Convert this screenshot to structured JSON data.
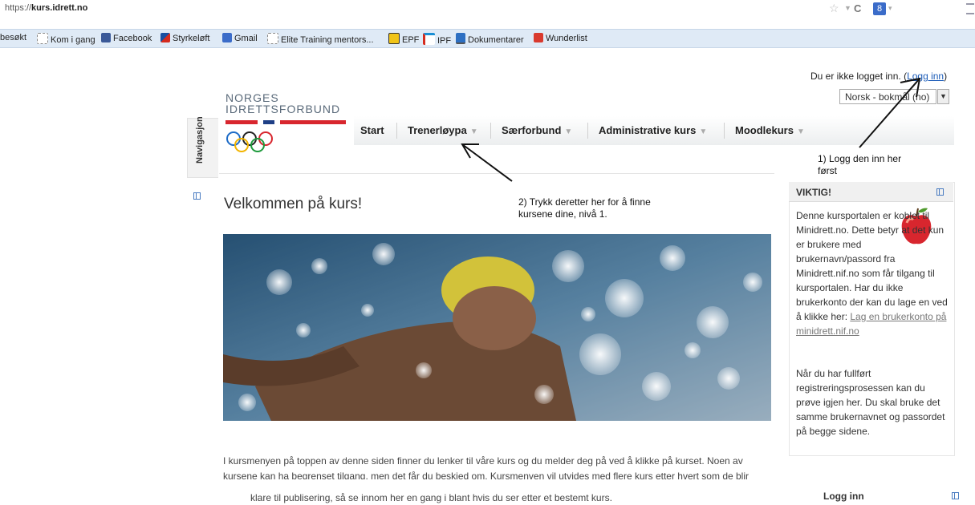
{
  "browser": {
    "url_scheme": "https://",
    "url_host": "kurs.idrett.no",
    "bookmarks": [
      {
        "label": "besøkt",
        "icon": "page-icon"
      },
      {
        "label": "Kom i gang",
        "icon": "page-icon"
      },
      {
        "label": "Facebook",
        "icon": "facebook-icon"
      },
      {
        "label": "Styrkeløft",
        "icon": "styrkeloft-icon"
      },
      {
        "label": "Gmail",
        "icon": "google-icon"
      },
      {
        "label": "Elite Training mentors...",
        "icon": "page-icon"
      },
      {
        "label": "EPF",
        "icon": "epf-icon"
      },
      {
        "label": "IPF",
        "icon": "ipf-icon"
      },
      {
        "label": "Dokumentarer",
        "icon": "monitor-icon"
      },
      {
        "label": "Wunderlist",
        "icon": "wunderlist-icon"
      }
    ],
    "google_badge": "8"
  },
  "header": {
    "logo_line1": "NORGES",
    "logo_line2": "IDRETTSFORBUND",
    "login_status": "Du er ikke logget inn. (",
    "login_link": "Logg inn",
    "login_status_end": ")",
    "language": "Norsk - bokmål (no)"
  },
  "nav": {
    "side_tab": "Navigasjon",
    "items": [
      {
        "label": "Start",
        "dropdown": false
      },
      {
        "label": "Trenerløypa",
        "dropdown": true
      },
      {
        "label": "Særforbund",
        "dropdown": true
      },
      {
        "label": "Administrative kurs",
        "dropdown": true
      },
      {
        "label": "Moodlekurs",
        "dropdown": true
      }
    ]
  },
  "main": {
    "welcome_title": "Velkommen på kurs!",
    "intro_line1": "I kursmenyen på toppen av denne siden finner du lenker til våre kurs og du melder deg på ved å klikke på kurset. Noen av",
    "intro_line2": "kursene kan ha begrenset tilgang, men det får du beskjed om. Kursmenyen vil utvides med flere kurs etter hvert som de blir",
    "intro_line3": "klare til publisering, så se innom her en gang i blant hvis du ser etter et bestemt kurs."
  },
  "viktig": {
    "title": "VIKTIG!",
    "p1": "Denne kursportalen er koblet til Minidrett.no. Dette betyr at det kun er brukere med brukernavn/passord fra Minidrett.nif.no som får tilgang til kursportalen. Har du ikke brukerkonto der kan du lage en ved å klikke her: ",
    "p1_link": "Lag en brukerkonto på minidrett.nif.no",
    "p2": "Når du har fullført registreringsprosessen kan du prøve igjen her. Du skal bruke det samme brukernavnet og passordet på begge sidene."
  },
  "login_block": {
    "title": "Logg inn"
  },
  "annotations": {
    "step1": "1) Logg den inn her først",
    "step2": "2) Trykk deretter her for å finne kursene dine, nivå 1."
  },
  "colors": {
    "flag_red": "#d8262e",
    "flag_blue": "#1e3f86",
    "link": "#1a5bb8"
  }
}
